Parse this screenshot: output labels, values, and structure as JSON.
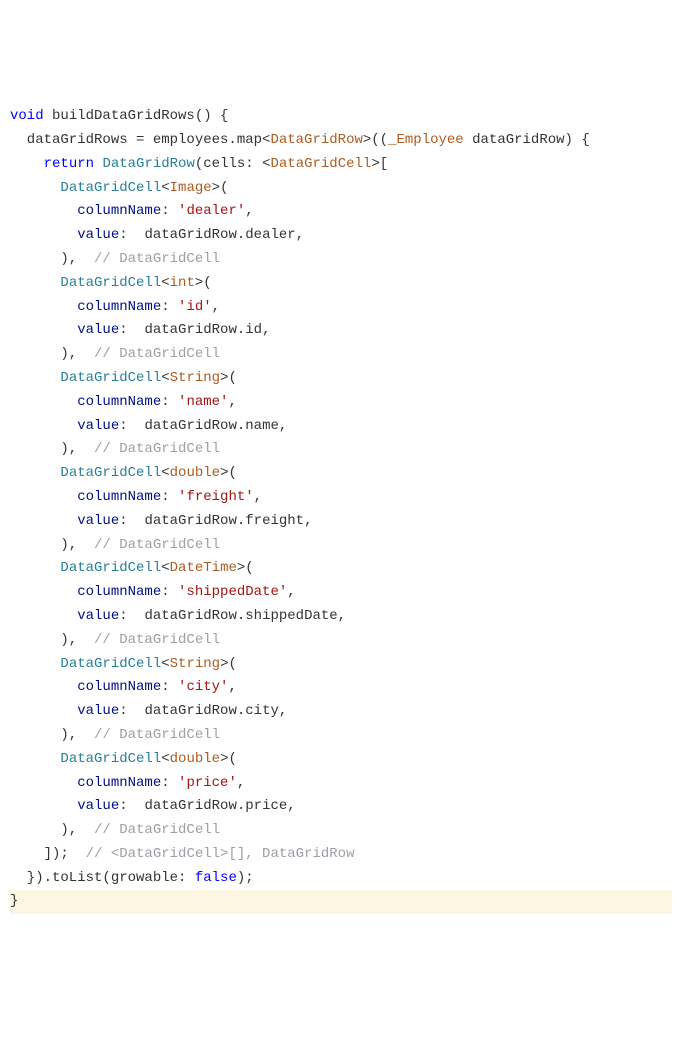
{
  "code": {
    "l1_kw": "void",
    "l1_fn": " buildDataGridRows() {",
    "l2_a": "  dataGridRows = employees.map<",
    "l2_t": "DataGridRow",
    "l2_b": ">((",
    "l2_pt": "_Employee",
    "l2_c": " dataGridRow) {",
    "l3_a": "    ",
    "l3_kw": "return",
    "l3_b": " ",
    "l3_ty": "DataGridRow",
    "l3_c": "(cells: <",
    "l3_ty2": "DataGridCell",
    "l3_d": ">[",
    "cell_open": "DataGridCell",
    "lt": "<",
    "gt": ">(",
    "type_image": "Image",
    "type_int": "int",
    "type_string": "String",
    "type_double": "double",
    "type_datetime": "DateTime",
    "col_label": "columnName",
    "val_label": "value",
    "col_dealer": "'dealer'",
    "val_dealer": " dataGridRow.dealer,",
    "col_id": "'id'",
    "val_id": " dataGridRow.id,",
    "col_name": "'name'",
    "val_name": " dataGridRow.name,",
    "col_freight": "'freight'",
    "val_freight": " dataGridRow.freight,",
    "col_shipped": "'shippedDate'",
    "val_shipped": " dataGridRow.shippedDate,",
    "col_city": "'city'",
    "val_city": " dataGridRow.city,",
    "col_price": "'price'",
    "val_price": " dataGridRow.price,",
    "close_cell": "      ),  ",
    "cmt_cell": "// DataGridCell",
    "close_list": "    ]);  ",
    "cmt_list": "// <DataGridCell>[], DataGridRow",
    "tolist_a": "  }).toList(growable: ",
    "tolist_false": "false",
    "tolist_b": ");",
    "close_fn": "}",
    "ind6": "      ",
    "ind8": "        ",
    "colon": ": ",
    "comma": ","
  }
}
